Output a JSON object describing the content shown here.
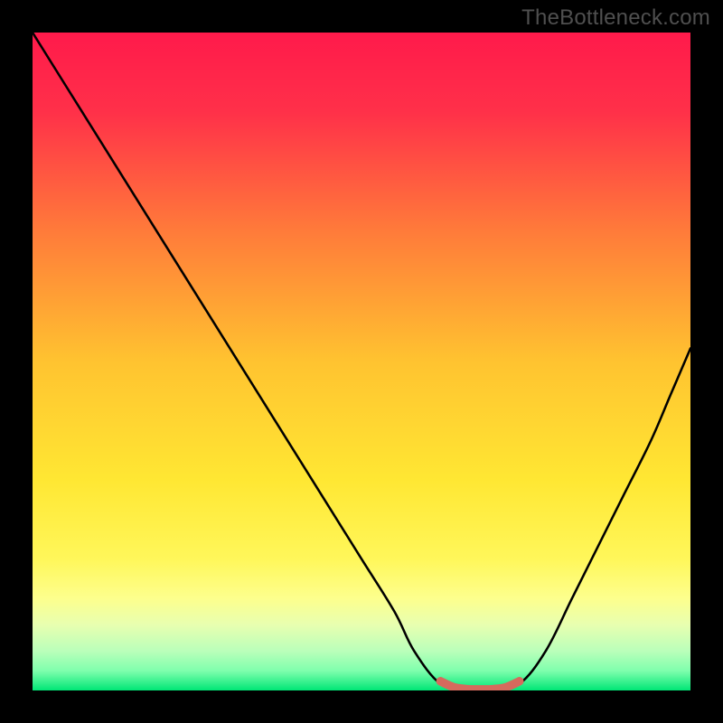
{
  "watermark": "TheBottleneck.com",
  "chart_data": {
    "type": "line",
    "title": "",
    "xlabel": "",
    "ylabel": "",
    "xlim": [
      0,
      100
    ],
    "ylim": [
      0,
      100
    ],
    "gradient_stops": [
      {
        "offset": 0.0,
        "color": "#ff1a4b"
      },
      {
        "offset": 0.12,
        "color": "#ff3049"
      },
      {
        "offset": 0.3,
        "color": "#ff7a3a"
      },
      {
        "offset": 0.5,
        "color": "#ffc330"
      },
      {
        "offset": 0.68,
        "color": "#ffe733"
      },
      {
        "offset": 0.8,
        "color": "#fff75a"
      },
      {
        "offset": 0.86,
        "color": "#fdff8d"
      },
      {
        "offset": 0.9,
        "color": "#e8ffb0"
      },
      {
        "offset": 0.94,
        "color": "#baffba"
      },
      {
        "offset": 0.97,
        "color": "#7fffad"
      },
      {
        "offset": 1.0,
        "color": "#00e676"
      }
    ],
    "series": [
      {
        "name": "bottleneck-curve",
        "color": "#000000",
        "x": [
          0,
          5,
          10,
          15,
          20,
          25,
          30,
          35,
          40,
          45,
          50,
          55,
          58,
          62,
          66,
          70,
          74,
          78,
          82,
          86,
          90,
          94,
          97,
          100
        ],
        "y": [
          100,
          92,
          84,
          76,
          68,
          60,
          52,
          44,
          36,
          28,
          20,
          12,
          6,
          1,
          0,
          0,
          1,
          6,
          14,
          22,
          30,
          38,
          45,
          52
        ]
      },
      {
        "name": "optimal-range-marker",
        "color": "#d66a5d",
        "x": [
          62,
          64,
          66,
          68,
          70,
          72,
          74
        ],
        "y": [
          1.4,
          0.5,
          0.2,
          0.15,
          0.2,
          0.5,
          1.4
        ]
      }
    ]
  }
}
